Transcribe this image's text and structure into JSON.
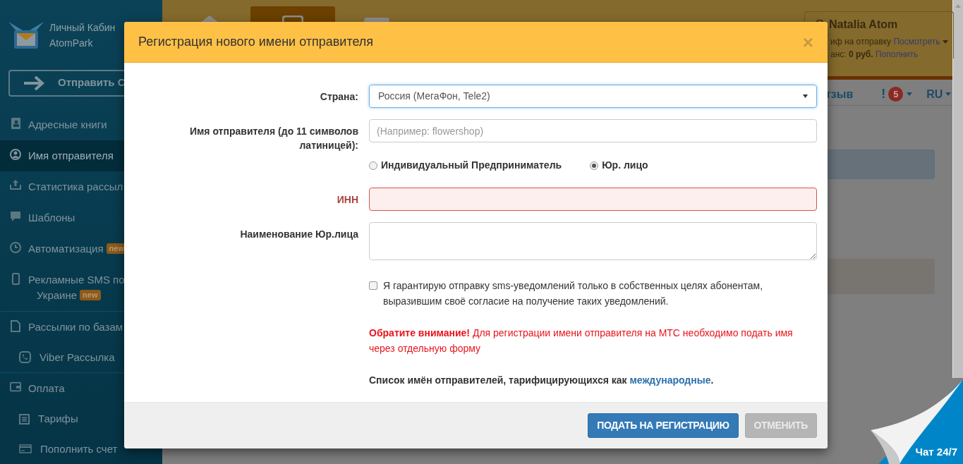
{
  "sidebar": {
    "brand": [
      "Личный Кабин",
      "AtomPark"
    ],
    "send_button": "Отправить С",
    "items": [
      {
        "label": "Адресные книги",
        "selected": false
      },
      {
        "label": "Имя отправителя",
        "selected": true
      },
      {
        "label": "Статистика рассыл",
        "selected": false
      },
      {
        "label": "Шаблоны",
        "selected": false
      },
      {
        "label": "Автоматизация",
        "badge": "new",
        "selected": false
      },
      {
        "label": "Рекламные SMS по",
        "label_2": "Украине",
        "badge": "new",
        "selected": false
      },
      {
        "label": "Рассылки по базам",
        "selected": false,
        "children": [
          {
            "label": "Viber Рассылка",
            "selected": false
          }
        ]
      },
      {
        "label": "Оплата",
        "selected": false,
        "children": [
          {
            "label": "Тарифы",
            "selected": false
          },
          {
            "label": "Пополнить счет",
            "selected": false
          }
        ]
      }
    ]
  },
  "header": {
    "user_name": "Natalia Atom",
    "tariff_label": "иф на отправку",
    "tariff_link": "Посмотреть",
    "balance_label": "анс:",
    "balance_value": "0 руб.",
    "balance_link": "Пополнить"
  },
  "nav": {
    "feedback": "тзыв",
    "alert_mark": "!",
    "alert_count": "5",
    "language": "RU"
  },
  "modal": {
    "title": "Регистрация нового имени отправителя",
    "close": "×",
    "country": {
      "label": "Страна:",
      "value": "Россия (МегаФон, Tele2)",
      "focused": true
    },
    "sender_name": {
      "label": "Имя отправителя (до 11 символов латиницей):",
      "placeholder": "(Например: flowershop)"
    },
    "entity_type": [
      {
        "label": "Индивидуальный Предприниматель",
        "selected": false
      },
      {
        "label": "Юр. лицо",
        "selected": true
      }
    ],
    "inn": {
      "label": "ИНН",
      "error": true
    },
    "company_name": {
      "label": "Наименование Юр.лица"
    },
    "consent": {
      "label": "Я гарантирую отправку sms-уведомлений только в собственных целях абонентам, выразившим своё согласие на получение таких уведомлений.",
      "checked": false
    },
    "warning": "**Обратите внимание!** Для регистрации имени отправителя на МТС необходимо подать имя через отдельную форму",
    "note": {
      "text": "Список имён отправителей, тарифицирующихся как",
      "link": "международные",
      "end": "."
    },
    "buttons": [
      {
        "label": "ПОДАТЬ НА РЕГИСТРАЦИЮ",
        "kind": "primary"
      },
      {
        "label": "ОТМЕНИТЬ",
        "kind": "secondary"
      }
    ]
  },
  "chat": {
    "label": "Чат 24/7"
  }
}
